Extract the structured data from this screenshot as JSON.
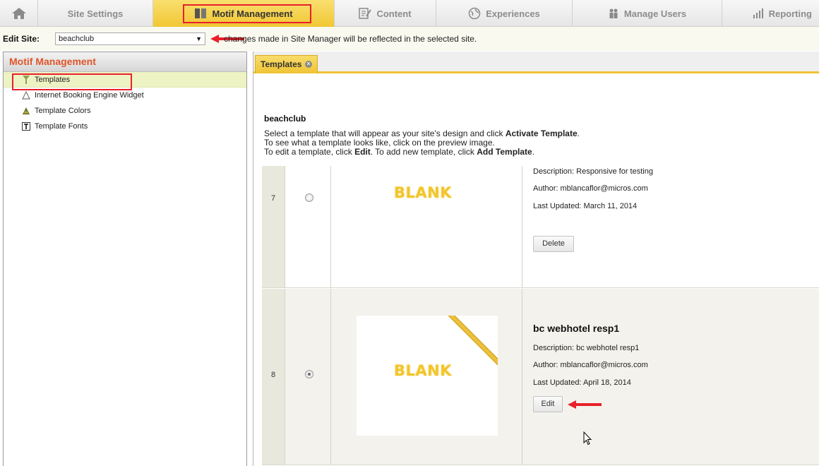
{
  "nav": {
    "tabs": [
      {
        "label": "Site Settings",
        "icon": "settings-icon"
      },
      {
        "label": "Motif Management",
        "icon": "motif-icon",
        "active": true
      },
      {
        "label": "Content",
        "icon": "content-icon"
      },
      {
        "label": "Experiences",
        "icon": "experiences-icon"
      },
      {
        "label": "Manage Users",
        "icon": "users-icon"
      },
      {
        "label": "Reporting",
        "icon": "reporting-icon"
      }
    ],
    "home_icon": "home-icon"
  },
  "site_bar": {
    "label": "Edit Site:",
    "selected_site": "beachclub",
    "note": "changes made in Site Manager will be reflected in the selected site."
  },
  "left_panel": {
    "title": "Motif Management",
    "items": [
      {
        "label": "Templates",
        "icon": "templates-icon",
        "selected": true
      },
      {
        "label": "Internet Booking Engine Widget",
        "icon": "widget-icon"
      },
      {
        "label": "Template Colors",
        "icon": "colors-icon"
      },
      {
        "label": "Template Fonts",
        "icon": "fonts-icon"
      }
    ]
  },
  "main": {
    "tab_label": "Templates",
    "site_name": "beachclub",
    "instructions": [
      {
        "pre": "Select a template that will appear as your site's design and click ",
        "bold": "Activate Template",
        "post": "."
      },
      {
        "pre": "To see what a template looks like, click on the preview image.",
        "bold": "",
        "post": ""
      },
      {
        "pre": "To edit a template, click ",
        "bold": "Edit",
        "post": ". To add new template, click ",
        "bold2": "Add Template",
        "post2": "."
      }
    ],
    "templates": [
      {
        "number": "7",
        "preview_text": "BLANK",
        "description": "Description: Responsive for testing",
        "author": "Author: mblancaflor@micros.com",
        "updated": "Last Updated: March 11, 2014",
        "button": "Delete",
        "selected": false
      },
      {
        "number": "8",
        "name": "bc webhotel resp1",
        "preview_text": "BLANK",
        "description": "Description: bc webhotel resp1",
        "author": "Author: mblancaflor@micros.com",
        "updated": "Last Updated: April 18, 2014",
        "button": "Edit",
        "selected": true
      }
    ]
  },
  "colors": {
    "accent_yellow": "#f0c330",
    "panel_title_orange": "#e0552a",
    "annotation_red": "#e8202a"
  }
}
